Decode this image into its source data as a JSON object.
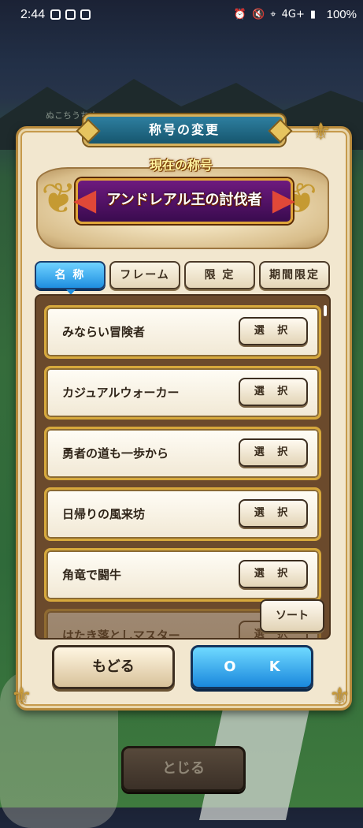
{
  "status_bar": {
    "time": "2:44",
    "network": "4G+",
    "battery": "100%"
  },
  "background": {
    "location_label": "ぬこちうちぬ"
  },
  "dialog": {
    "title": "称号の変更",
    "current_title_label": "現在の称号",
    "current_title": "アンドレアル王の討伐者"
  },
  "tabs": [
    {
      "label": "名 称",
      "active": true
    },
    {
      "label": "フレーム",
      "active": false
    },
    {
      "label": "限 定",
      "active": false
    },
    {
      "label": "期間限定",
      "active": false
    }
  ],
  "title_list": [
    {
      "name": "みならい冒険者",
      "button": "選 択"
    },
    {
      "name": "カジュアルウォーカー",
      "button": "選 択"
    },
    {
      "name": "勇者の道も一歩から",
      "button": "選 択"
    },
    {
      "name": "日帰りの風来坊",
      "button": "選 択"
    },
    {
      "name": "角竜で闘牛",
      "button": "選 択"
    },
    {
      "name": "はたき落としマスター",
      "button": "選 択"
    }
  ],
  "buttons": {
    "sort": "ソート",
    "back": "もどる",
    "ok": "O K",
    "close": "とじる"
  },
  "colors": {
    "accent_blue": "#1f8fe0",
    "gold_border": "#d7a93c",
    "panel_bg": "#f2e7cf"
  }
}
